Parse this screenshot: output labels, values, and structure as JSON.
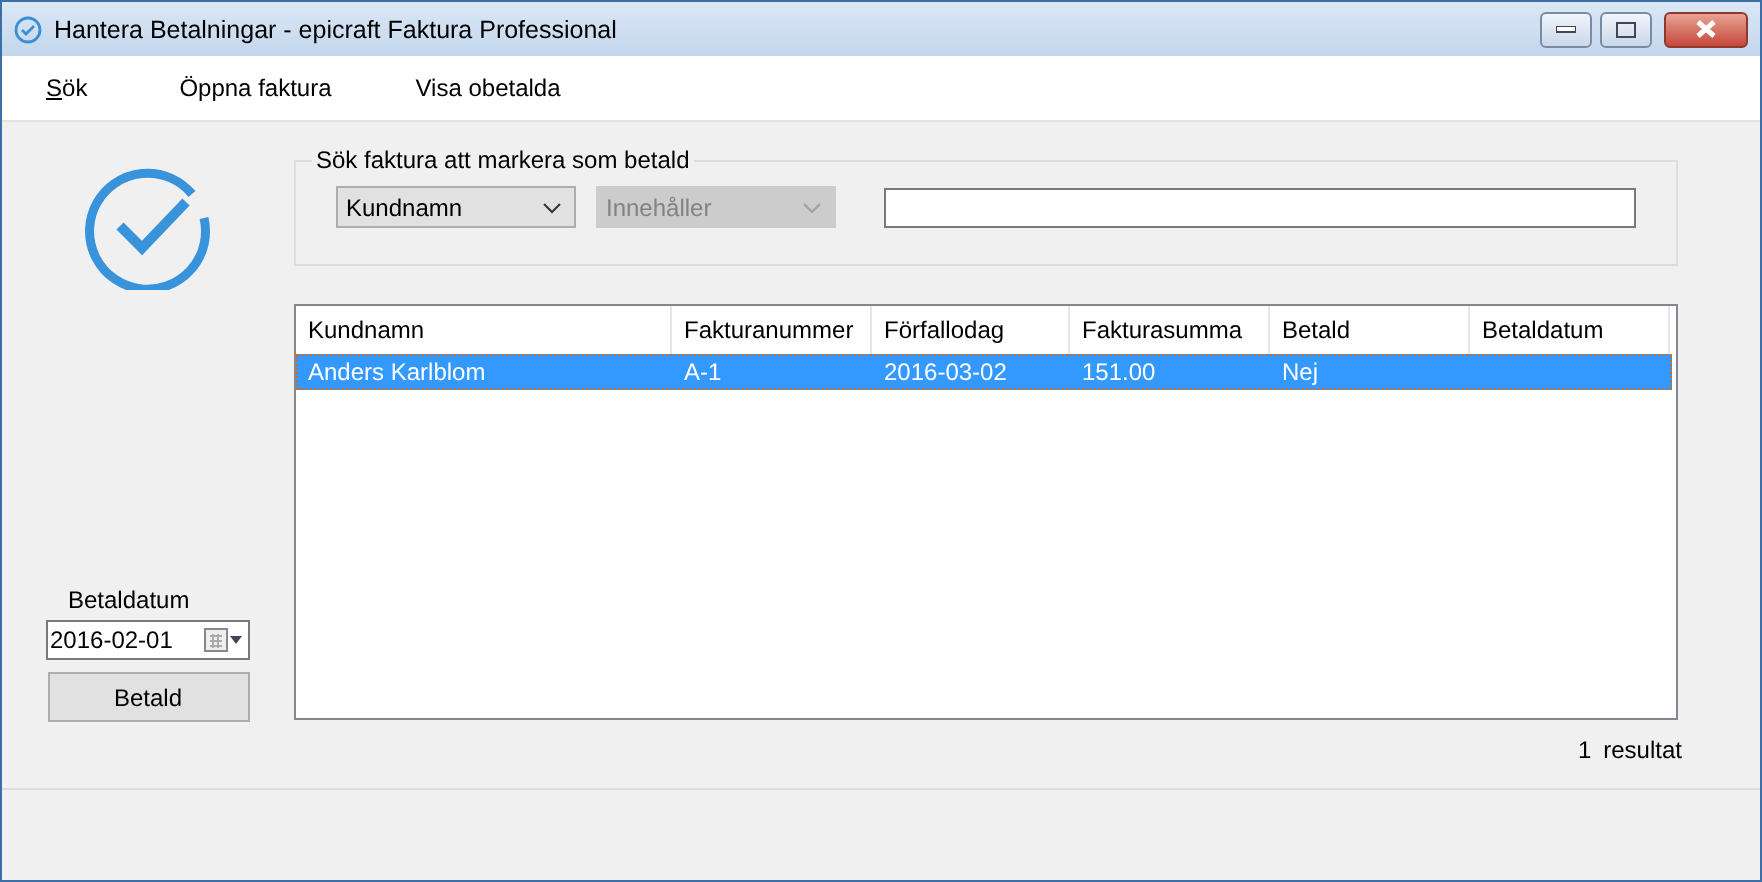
{
  "window": {
    "title": "Hantera Betalningar - epicraft Faktura Professional"
  },
  "menu": [
    {
      "label": "Sök",
      "mnemonic_underlined": true
    },
    {
      "label": "Öppna faktura",
      "mnemonic_underlined": false
    },
    {
      "label": "Visa obetalda",
      "mnemonic_underlined": false
    }
  ],
  "payment": {
    "date_label": "Betaldatum",
    "date_value": "2016-02-01",
    "button": "Betald"
  },
  "search": {
    "legend": "Sök faktura att markera som betald",
    "field_dropdown": {
      "value": "Kundnamn",
      "disabled": false
    },
    "operator_dropdown": {
      "value": "Innehåller",
      "disabled": true
    }
  },
  "table": {
    "columns": [
      "Kundnamn",
      "Fakturanummer",
      "Förfallodag",
      "Fakturasumma",
      "Betald",
      "Betaldatum"
    ],
    "rows": [
      {
        "cells": [
          "Anders Karlblom",
          "A-1",
          "2016-03-02",
          "151.00",
          "Nej",
          ""
        ],
        "selected": true
      }
    ]
  },
  "result_count": {
    "count": "1",
    "label": "resultat"
  }
}
